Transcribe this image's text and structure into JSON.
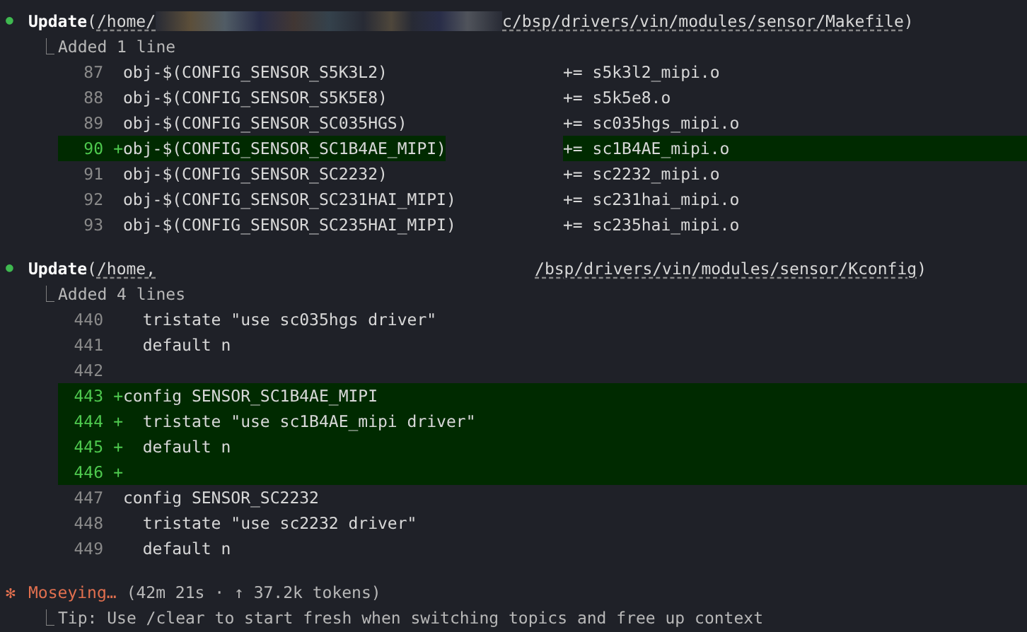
{
  "updates": [
    {
      "kind": "columns",
      "bullet": "●",
      "action": "Update",
      "open_paren": "(",
      "path_start": "/home/",
      "redacted": true,
      "path_end": "c/bsp/drivers/vin/modules/sensor/Makefile",
      "close_paren": ")",
      "branch": "⎿",
      "summary": "Added 1 line",
      "lines": [
        {
          "number": "87",
          "added": false,
          "code": "obj-$(CONFIG_SENSOR_S5K3L2)",
          "value": "+= s5k3l2_mipi.o"
        },
        {
          "number": "88",
          "added": false,
          "code": "obj-$(CONFIG_SENSOR_S5K5E8)",
          "value": "+= s5k5e8.o"
        },
        {
          "number": "89",
          "added": false,
          "code": "obj-$(CONFIG_SENSOR_SC035HGS)",
          "value": "+= sc035hgs_mipi.o"
        },
        {
          "number": "90",
          "added": true,
          "sign": "+",
          "code": "obj-$(CONFIG_SENSOR_SC1B4AE_MIPI)",
          "value": "+= sc1B4AE_mipi.o"
        },
        {
          "number": "91",
          "added": false,
          "code": "obj-$(CONFIG_SENSOR_SC2232)",
          "value": "+= sc2232_mipi.o"
        },
        {
          "number": "92",
          "added": false,
          "code": "obj-$(CONFIG_SENSOR_SC231HAI_MIPI)",
          "value": "+= sc231hai_mipi.o"
        },
        {
          "number": "93",
          "added": false,
          "code": "obj-$(CONFIG_SENSOR_SC235HAI_MIPI)",
          "value": "+= sc235hai_mipi.o"
        }
      ]
    },
    {
      "kind": "single",
      "bullet": "●",
      "action": "Update",
      "open_paren": "(",
      "path_start": "/home,",
      "redacted": false,
      "path_end": "/bsp/drivers/vin/modules/sensor/Kconfig",
      "close_paren": ")",
      "branch": "⎿",
      "summary": "Added 4 lines",
      "lines": [
        {
          "number": "440",
          "added": false,
          "code": "  tristate \"use sc035hgs driver\""
        },
        {
          "number": "441",
          "added": false,
          "code": "  default n"
        },
        {
          "number": "442",
          "added": false
        },
        {
          "number": "443",
          "added": true,
          "sign": "+",
          "code": "config SENSOR_SC1B4AE_MIPI"
        },
        {
          "number": "444",
          "added": true,
          "sign": "+",
          "code": "  tristate \"use sc1B4AE_mipi driver\""
        },
        {
          "number": "445",
          "added": true,
          "sign": "+",
          "code": "  default n"
        },
        {
          "number": "446",
          "added": true,
          "sign": "+"
        },
        {
          "number": "447",
          "added": false,
          "code": "config SENSOR_SC2232"
        },
        {
          "number": "448",
          "added": false,
          "code": "  tristate \"use sc2232 driver\""
        },
        {
          "number": "449",
          "added": false,
          "code": "  default n"
        }
      ]
    }
  ],
  "status": {
    "icon": "✻",
    "verb": "Moseying…",
    "detail": "(42m 21s · ↑ 37.2k tokens)",
    "branch": "⎿",
    "tip": "Tip: Use /clear to start fresh when switching topics and free up context"
  }
}
